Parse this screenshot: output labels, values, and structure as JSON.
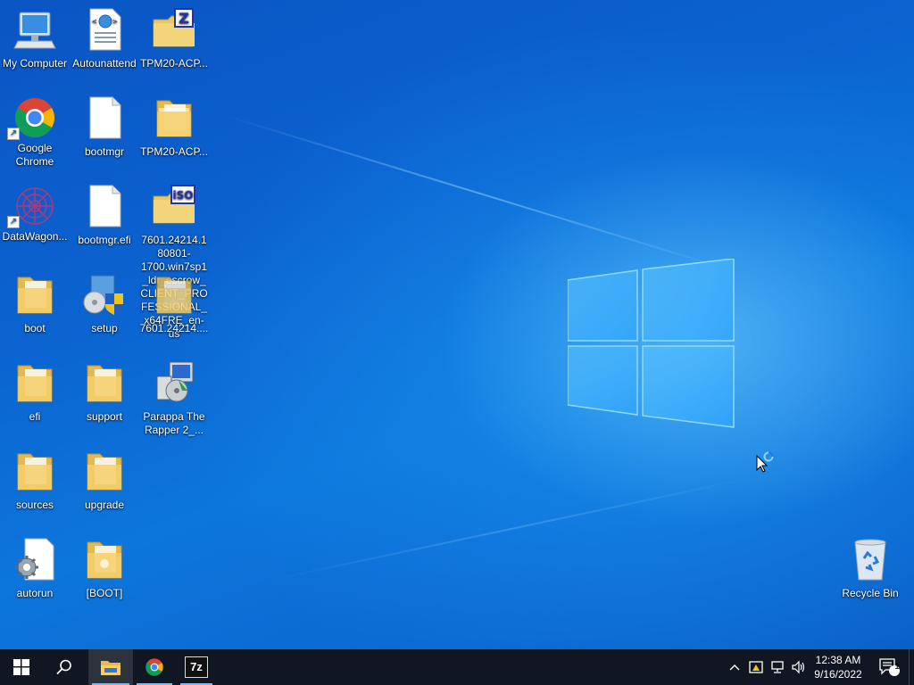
{
  "desktop": {
    "icons": [
      {
        "label": "My Computer"
      },
      {
        "label": "Autounattend"
      },
      {
        "label": "TPM20-ACP..."
      },
      {
        "label": "Google Chrome"
      },
      {
        "label": "bootmgr"
      },
      {
        "label": "TPM20-ACP..."
      },
      {
        "label": "DataWagon..."
      },
      {
        "label": "bootmgr.efi"
      },
      {
        "label": "7601.24214.180801-1700.win7sp1_ldr_escrow_CLIENT_PROFESSIONAL_x64FRE_en-us"
      },
      {
        "label": "boot"
      },
      {
        "label": "setup"
      },
      {
        "label": "7601.24214...."
      },
      {
        "label": "efi"
      },
      {
        "label": "support"
      },
      {
        "label": "Parappa The Rapper 2_..."
      },
      {
        "label": "sources"
      },
      {
        "label": "upgrade"
      },
      {
        "label": "autorun"
      },
      {
        "label": "[BOOT]"
      },
      {
        "label": "Recycle Bin"
      }
    ],
    "badges": {
      "zip_letter": "Z",
      "iso_text": "iSO"
    }
  },
  "taskbar": {
    "apps": [
      "start-button",
      "search-button",
      "file-explorer",
      "google-chrome",
      "7-zip"
    ],
    "seven_zip_label": "7z",
    "clock": {
      "time": "12:38 AM",
      "date": "9/16/2022"
    },
    "notifications_count": "1"
  },
  "colors": {
    "taskbar": "#101722",
    "desktop_blue": "#0b63d0",
    "accent": "#7db8f0"
  }
}
